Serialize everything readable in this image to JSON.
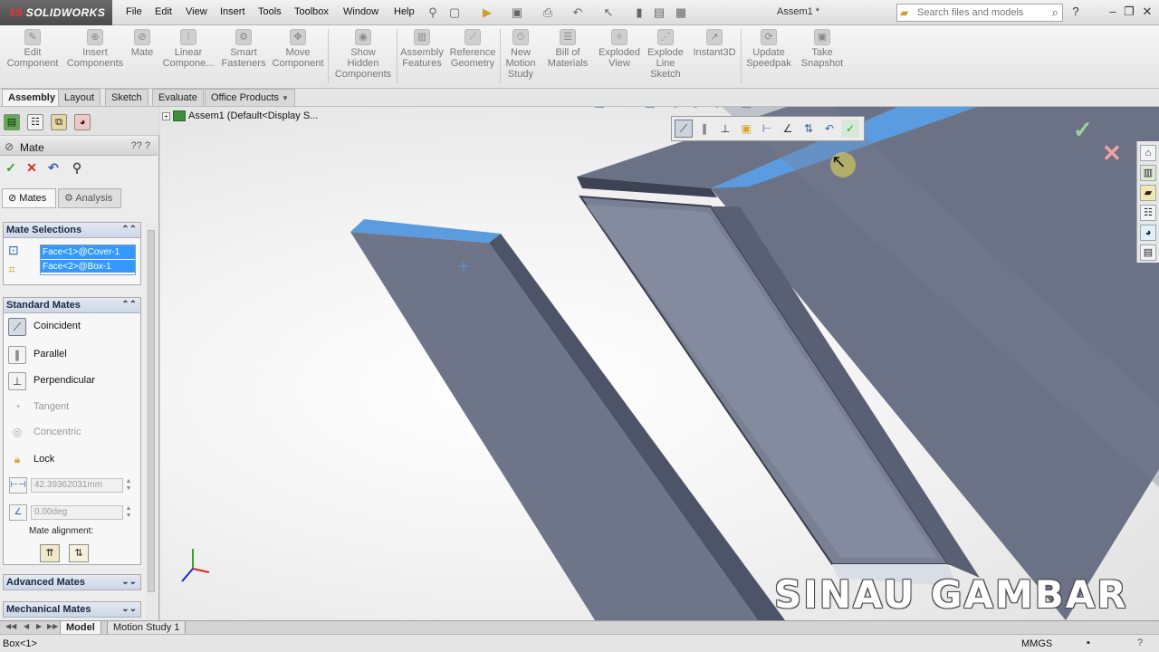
{
  "app": {
    "logo_brand": "3S",
    "logo_name": "SOLIDWORKS",
    "document_title": "Assem1 *"
  },
  "menu": [
    "File",
    "Edit",
    "View",
    "Insert",
    "Tools",
    "Toolbox",
    "Window",
    "Help"
  ],
  "search": {
    "placeholder": "Search files and models"
  },
  "commands": [
    {
      "label": "Edit\nComponent",
      "icon": "edit-component-icon"
    },
    {
      "label": "Insert\nComponents",
      "icon": "insert-components-icon"
    },
    {
      "label": "Mate",
      "icon": "mate-icon"
    },
    {
      "label": "Linear\nCompone...",
      "icon": "linear-pattern-icon"
    },
    {
      "label": "Smart\nFasteners",
      "icon": "smart-fasteners-icon"
    },
    {
      "label": "Move\nComponent",
      "icon": "move-component-icon"
    },
    {
      "label": "Show\nHidden\nComponents",
      "icon": "show-hidden-icon"
    },
    {
      "label": "Assembly\nFeatures",
      "icon": "assembly-features-icon"
    },
    {
      "label": "Reference\nGeometry",
      "icon": "reference-geometry-icon"
    },
    {
      "label": "New\nMotion\nStudy",
      "icon": "motion-study-icon"
    },
    {
      "label": "Bill of\nMaterials",
      "icon": "bom-icon"
    },
    {
      "label": "Exploded\nView",
      "icon": "exploded-view-icon"
    },
    {
      "label": "Explode\nLine\nSketch",
      "icon": "explode-line-icon"
    },
    {
      "label": "Instant3D",
      "icon": "instant3d-icon"
    },
    {
      "label": "Update\nSpeedpak",
      "icon": "speedpak-icon"
    },
    {
      "label": "Take\nSnapshot",
      "icon": "snapshot-icon"
    }
  ],
  "tabs": [
    "Assembly",
    "Layout",
    "Sketch",
    "Evaluate",
    "Office Products"
  ],
  "property_manager": {
    "title": "Mate",
    "tab_mates": "Mates",
    "tab_analysis": "Analysis",
    "mate_selections_title": "Mate Selections",
    "selections": [
      "Face<1>@Cover-1",
      "Face<2>@Box-1"
    ],
    "standard_mates_title": "Standard Mates",
    "standard_mates": [
      {
        "label": "Coincident",
        "enabled": true
      },
      {
        "label": "Parallel",
        "enabled": true
      },
      {
        "label": "Perpendicular",
        "enabled": true
      },
      {
        "label": "Tangent",
        "enabled": false
      },
      {
        "label": "Concentric",
        "enabled": false
      },
      {
        "label": "Lock",
        "enabled": true
      }
    ],
    "distance_value": "42.39362031mm",
    "angle_value": "0.00deg",
    "mate_alignment_label": "Mate alignment:",
    "advanced_mates_title": "Advanced Mates",
    "mechanical_mates_title": "Mechanical Mates"
  },
  "feature_tree": {
    "root": "Assem1  (Default<Display S..."
  },
  "watermark": "SINAU GAMBAR",
  "bottom_tabs": [
    "Model",
    "Motion Study 1"
  ],
  "status": {
    "left": "Box<1>",
    "units": "MMGS"
  },
  "colors": {
    "selected_face": "#5b9be0",
    "part_gray": "#6f7589",
    "selection_blue": "#3399ff"
  }
}
